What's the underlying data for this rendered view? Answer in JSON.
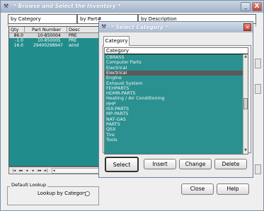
{
  "window": {
    "title": "* Browse and Select the Inventory *",
    "minimize_glyph": "_",
    "close_glyph": "X"
  },
  "tabs": [
    {
      "label": "by Category"
    },
    {
      "label": "by Part#"
    },
    {
      "label": "by Description"
    }
  ],
  "grid": {
    "columns": [
      "Qty",
      "Part Number",
      "Desc"
    ],
    "rows": [
      {
        "qty": "86.0",
        "part": "10-850004",
        "desc": "PRE"
      },
      {
        "qty": "-1.0",
        "part": "10-850005",
        "desc": "PRE"
      },
      {
        "qty": "16.0",
        "part": "29400298947",
        "desc": "wind"
      }
    ]
  },
  "navigator": {
    "buttons": [
      "|◂",
      "◂◂",
      "◂",
      "▸",
      "▸▸",
      "▸|",
      "◂"
    ]
  },
  "default_lookup": {
    "group_title": "Default Lookup",
    "label": "Lookup by Category"
  },
  "main_buttons": {
    "close": "Close",
    "help": "Help"
  },
  "dialog": {
    "title": "* Select Category *",
    "close_glyph": "✕",
    "tab_label": "Category",
    "list_header": "Category",
    "selected_index": 3,
    "items": [
      "CBRASS",
      "Computer Parts",
      "Electrical",
      "Electrical",
      "Engine",
      "Exhaust System",
      "FEHPARTS",
      "HDMR-PARTS",
      "Heating / Air Conditioning",
      "HHP",
      "ISX-PARTS",
      "MP-PARTS",
      "NAT-GAS",
      "PARTS",
      "QSX",
      "Tire",
      "Tools"
    ],
    "buttons": {
      "select": "Select",
      "insert": "Insert",
      "change": "Change",
      "delete": "Delete"
    }
  }
}
